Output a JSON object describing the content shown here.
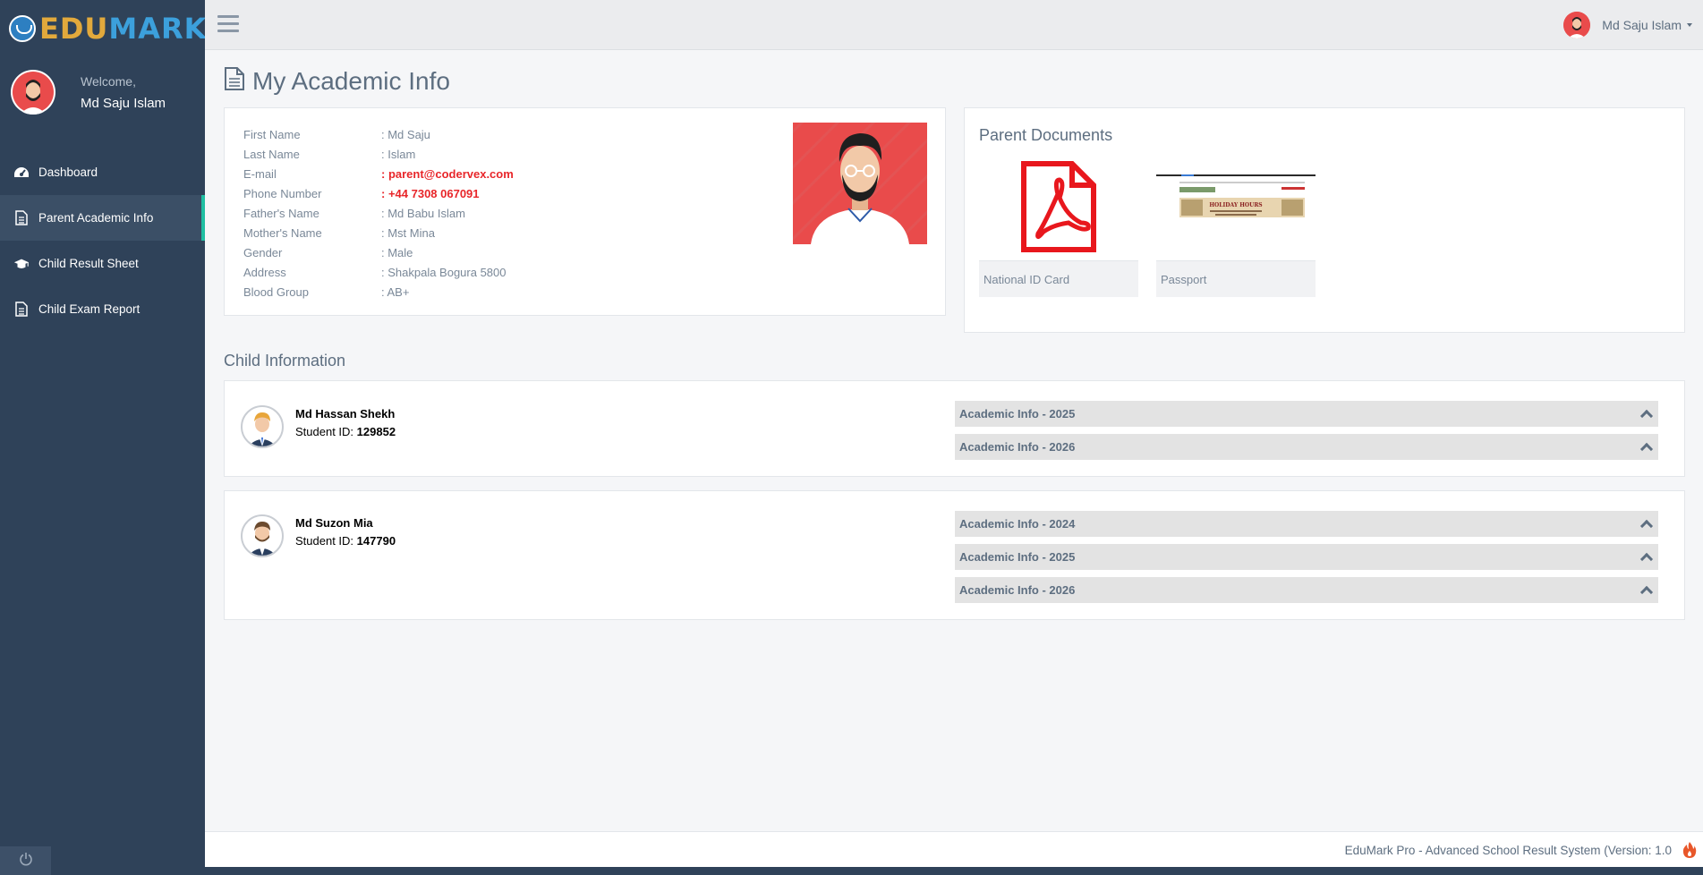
{
  "app": {
    "logo_part1": "EDU",
    "logo_part2": "MARK",
    "colors": {
      "sidebar": "#2f4259",
      "accent": "#1fbfa2",
      "danger": "#e8262a",
      "logo_gold": "#e2a93c",
      "logo_blue": "#3ca0dc"
    }
  },
  "sidebar": {
    "welcome": "Welcome,",
    "user_name": "Md Saju Islam",
    "items": [
      {
        "label": "Dashboard",
        "icon": "dashboard-icon"
      },
      {
        "label": "Parent Academic Info",
        "icon": "document-icon",
        "active": true
      },
      {
        "label": "Child Result Sheet",
        "icon": "graduation-cap-icon"
      },
      {
        "label": "Child Exam Report",
        "icon": "document-icon"
      }
    ],
    "power_icon": "power-icon"
  },
  "topbar": {
    "user_name": "Md Saju Islam",
    "menu_icon": "hamburger-icon"
  },
  "page": {
    "title": "My Academic Info",
    "title_icon": "document-icon"
  },
  "profile": {
    "rows": [
      {
        "label": "First Name",
        "value": ": Md Saju"
      },
      {
        "label": "Last Name",
        "value": ": Islam"
      },
      {
        "label": "E-mail",
        "value": ": parent@codervex.com",
        "highlight": true
      },
      {
        "label": "Phone Number",
        "value": ": +44 7308 067091",
        "highlight": true
      },
      {
        "label": "Father's Name",
        "value": ": Md Babu Islam"
      },
      {
        "label": "Mother's Name",
        "value": ": Mst Mina"
      },
      {
        "label": "Gender",
        "value": ": Male"
      },
      {
        "label": "Address",
        "value": ": Shakpala Bogura 5800"
      },
      {
        "label": "Blood Group",
        "value": ": AB+"
      }
    ]
  },
  "documents": {
    "title": "Parent Documents",
    "items": [
      {
        "caption": "National ID Card",
        "icon": "pdf-icon"
      },
      {
        "caption": "Passport",
        "icon": "image-thumbnail",
        "thumb_text": "HOLIDAY HOURS"
      }
    ]
  },
  "children": {
    "title": "Child Information",
    "id_label": "Student ID:",
    "list": [
      {
        "name": "Md Hassan Shekh",
        "student_id": "129852",
        "academics": [
          "Academic Info - 2025",
          "Academic Info - 2026"
        ]
      },
      {
        "name": "Md Suzon Mia",
        "student_id": "147790",
        "academics": [
          "Academic Info - 2024",
          "Academic Info - 2025",
          "Academic Info - 2026"
        ]
      }
    ]
  },
  "footer": {
    "text": "EduMark Pro - Advanced School Result System (Version: 1.0",
    "icon": "flame-icon"
  }
}
